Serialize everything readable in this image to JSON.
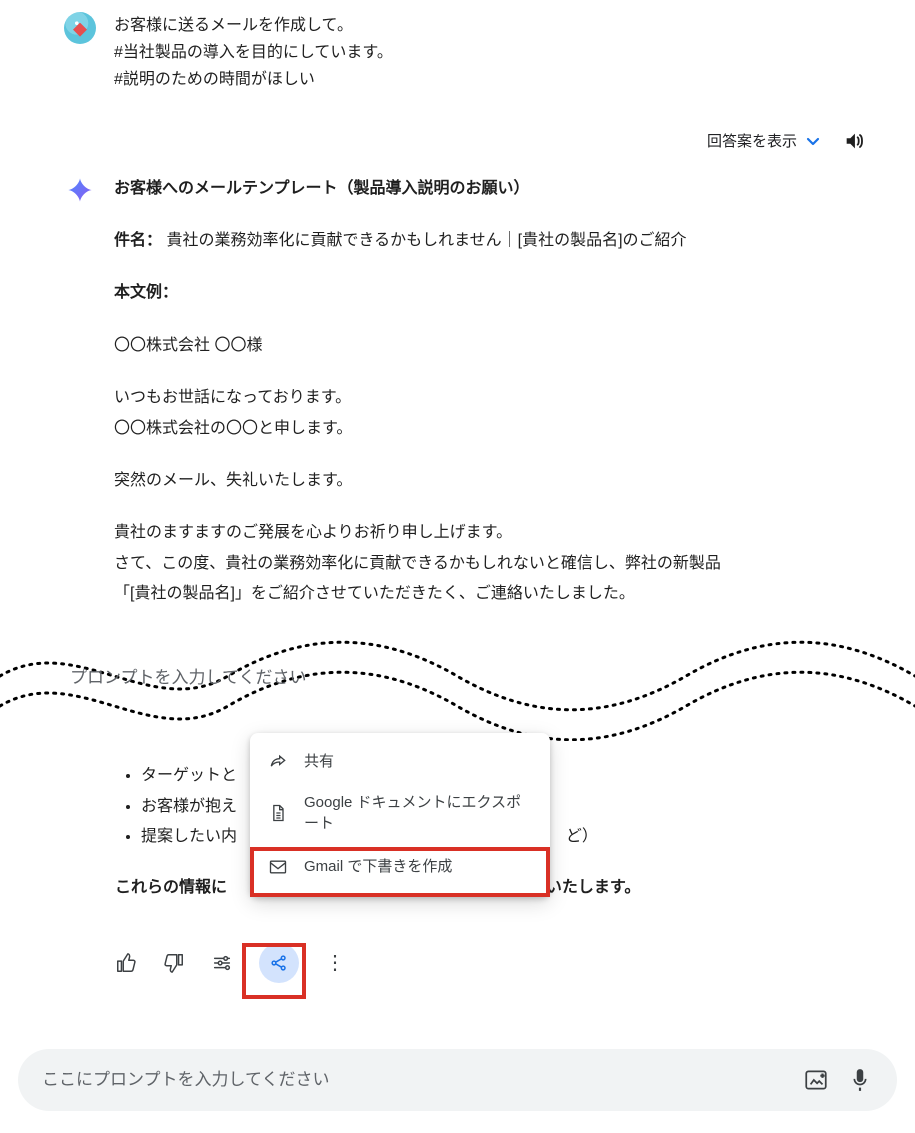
{
  "user": {
    "line1": "お客様に送るメールを作成して。",
    "line2": "#当社製品の導入を目的にしています。",
    "line3": "#説明のための時間がほしい"
  },
  "controls": {
    "show_answers": "回答案を表示"
  },
  "assistant": {
    "title": "お客様へのメールテンプレート（製品導入説明のお願い）",
    "subject_label": "件名：",
    "subject_text": "貴社の業務効率化に貢献できるかもしれません｜[貴社の製品名]のご紹介",
    "body_label": "本文例：",
    "p1": "〇〇株式会社 〇〇様",
    "p2a": "いつもお世話になっております。",
    "p2b": "〇〇株式会社の〇〇と申します。",
    "p3": "突然のメール、失礼いたします。",
    "p4a": "貴社のますますのご発展を心よりお祈り申し上げます。",
    "p4b": "さて、この度、貴社の業務効率化に貢献できるかもしれないと確信し、弊社の新製品",
    "p4c": "「[貴社の製品名]」をご紹介させていただきたく、ご連絡いたしました。"
  },
  "ghost_prompt": "プロンプトを入力してください",
  "bullets": {
    "b1": "ターゲットと",
    "b2": "お客様が抱え",
    "b3_pre": "提案したい内",
    "b3_post": "ど）"
  },
  "closing": {
    "pre": "これらの情報に",
    "post": "いたします。"
  },
  "menu": {
    "share": "共有",
    "docs": "Google ドキュメントにエクスポート",
    "gmail": "Gmail で下書きを作成"
  },
  "prompt": {
    "placeholder": "ここにプロンプトを入力してください"
  }
}
